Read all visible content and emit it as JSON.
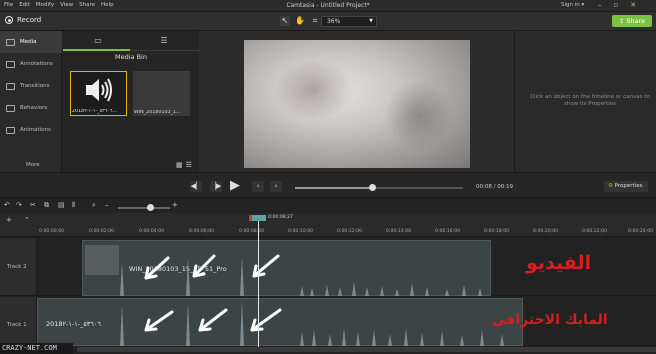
{
  "titlebar": {
    "menu": [
      "File",
      "Edit",
      "Modify",
      "View",
      "Share",
      "Help"
    ],
    "title": "Camtasia - Untitled Project*",
    "signin": "Sign in ▾"
  },
  "toolbar": {
    "record_label": "Record",
    "zoom_value": "36%",
    "share_label": "Share"
  },
  "sidebar": {
    "items": [
      {
        "label": "Media"
      },
      {
        "label": "Annotations"
      },
      {
        "label": "Transitions"
      },
      {
        "label": "Behaviors"
      },
      {
        "label": "Animations"
      }
    ],
    "more_label": "More"
  },
  "media_bin": {
    "title": "Media Bin",
    "items": [
      {
        "caption": "2018٥٣٦٠٦_-١-١-٢..."
      },
      {
        "caption": "WIN_20180103_1..."
      }
    ]
  },
  "properties": {
    "hint": "Click an object on the timeline or canvas to show its Properties",
    "button_label": "Properties"
  },
  "playback": {
    "time": "00:08 / 00:19",
    "progress": 0.46
  },
  "timeline": {
    "ticks": [
      "0:00:00;00",
      "0:00:02;00",
      "0:00:04;00",
      "0:00:06;00",
      "0:00:08;00",
      "0:00:10;00",
      "0:00:12;00",
      "0:00:14;00",
      "0:00:16;00",
      "0:00:18;00",
      "0:00:20;00",
      "0:00:22;00",
      "0:00:24;00"
    ],
    "playhead_time": "0:00:08;27",
    "tracks": [
      {
        "name": "Track 2",
        "clip_label": "WIN_20180103_15_25_51_Pro"
      },
      {
        "name": "Track 1",
        "clip_label": "2018٥٣٦٠٦_-١-١-٢"
      }
    ]
  },
  "annotations": {
    "video_label": "الفيديو",
    "mic_label": "المايك الاحترافي"
  },
  "watermark": "CRAZY-NET.COM",
  "colors": {
    "accent_green": "#7cc242",
    "annotation_red": "#d41f1f",
    "playhead_teal": "#5fa3a0"
  }
}
